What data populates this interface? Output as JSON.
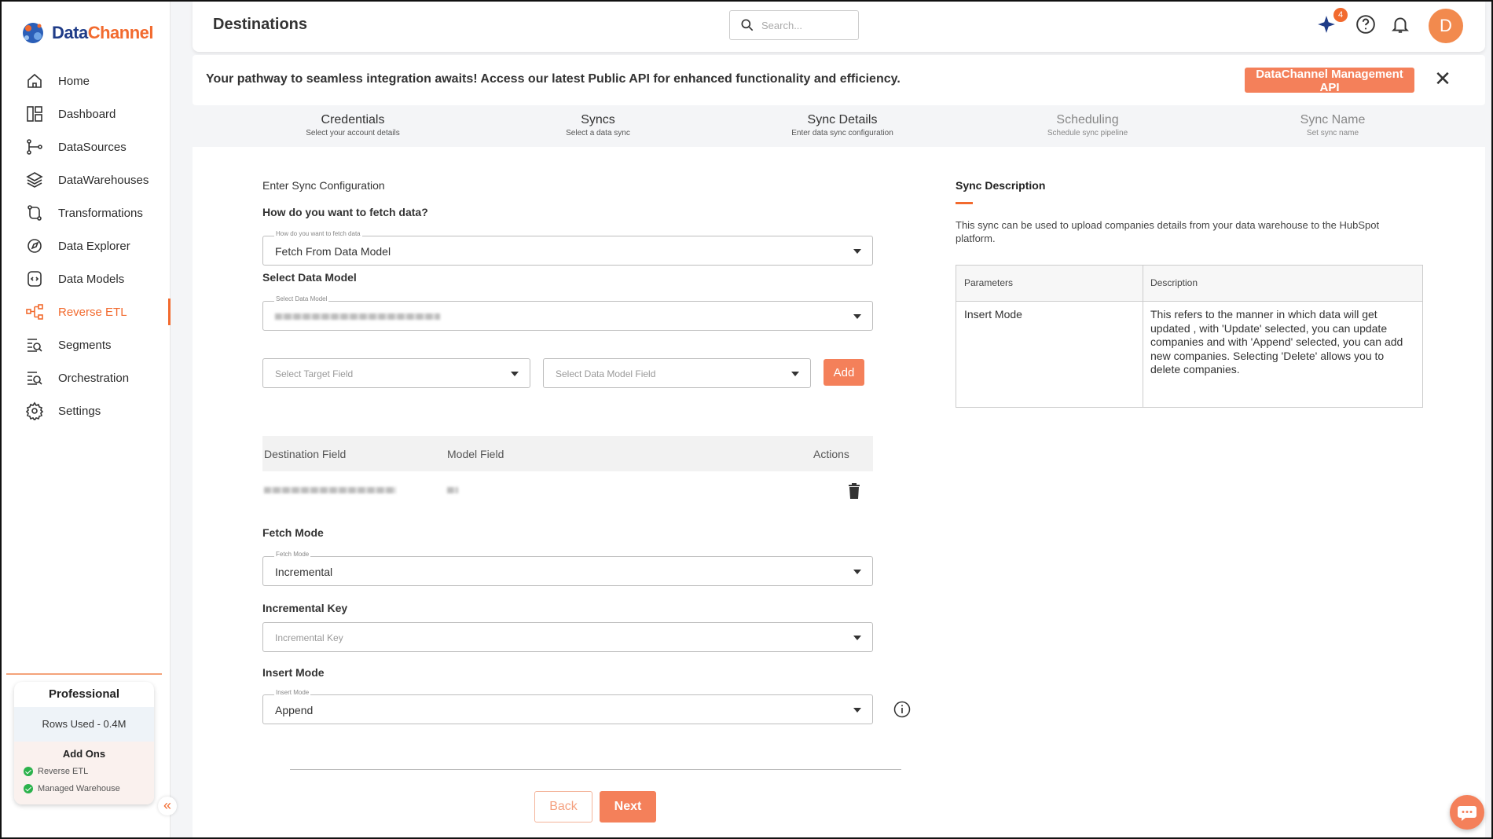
{
  "app": {
    "brand_part1": "Data",
    "brand_part2": "Channel",
    "accent_color": "#f26a2e"
  },
  "sidebar": {
    "items": [
      {
        "label": "Home",
        "icon": "home-icon"
      },
      {
        "label": "Dashboard",
        "icon": "dashboard-icon"
      },
      {
        "label": "DataSources",
        "icon": "datasources-icon"
      },
      {
        "label": "DataWarehouses",
        "icon": "layers-icon"
      },
      {
        "label": "Transformations",
        "icon": "transform-icon"
      },
      {
        "label": "Data Explorer",
        "icon": "explorer-icon"
      },
      {
        "label": "Data Models",
        "icon": "data-model-icon"
      },
      {
        "label": "Reverse ETL",
        "icon": "reverse-etl-icon",
        "active": true
      },
      {
        "label": "Segments",
        "icon": "segments-icon"
      },
      {
        "label": "Orchestration",
        "icon": "orchestration-icon"
      },
      {
        "label": "Settings",
        "icon": "gear-icon"
      }
    ],
    "plan": {
      "title": "Professional",
      "rows_used": "Rows Used - 0.4M",
      "addons_title": "Add Ons",
      "addons": [
        "Reverse ETL",
        "Managed Warehouse"
      ]
    }
  },
  "header": {
    "title": "Destinations",
    "search_placeholder": "Search...",
    "notifications_count": "4",
    "avatar_initial": "D"
  },
  "banner": {
    "text": "Your pathway to seamless integration awaits! Access our latest Public API for enhanced functionality and efficiency.",
    "button_label": "DataChannel Management API"
  },
  "stepper": [
    {
      "title": "Credentials",
      "sub": "Select your account details",
      "state": "done"
    },
    {
      "title": "Syncs",
      "sub": "Select a data sync",
      "state": "done"
    },
    {
      "title": "Sync Details",
      "sub": "Enter data sync configuration",
      "state": "current"
    },
    {
      "title": "Scheduling",
      "sub": "Schedule sync pipeline",
      "state": "pending"
    },
    {
      "title": "Sync Name",
      "sub": "Set sync name",
      "state": "pending"
    }
  ],
  "form": {
    "section_title": "Enter Sync Configuration",
    "fetch_question": "How do you want to fetch data?",
    "fetch_legend": "How do you want to fetch data",
    "fetch_value": "Fetch From Data Model",
    "select_model_label": "Select Data Model",
    "select_model_legend": "Select Data Model",
    "target_field_placeholder": "Select Target Field",
    "model_field_placeholder": "Select Data Model Field",
    "add_label": "Add",
    "mapping_headers": {
      "destination": "Destination Field",
      "model": "Model Field",
      "actions": "Actions"
    },
    "fetch_mode_label": "Fetch Mode",
    "fetch_mode_legend": "Fetch Mode",
    "fetch_mode_value": "Incremental",
    "incremental_key_label": "Incremental Key",
    "incremental_key_placeholder": "Incremental Key",
    "insert_mode_label": "Insert Mode",
    "insert_mode_legend": "Insert Mode",
    "insert_mode_value": "Append",
    "back_label": "Back",
    "next_label": "Next"
  },
  "description": {
    "title": "Sync Description",
    "text": "This sync can be used to upload companies details from your data warehouse to the HubSpot platform.",
    "table_headers": {
      "param": "Parameters",
      "desc": "Description"
    },
    "rows": [
      {
        "param": "Insert Mode",
        "desc": "This refers to the manner in which data will get updated , with 'Update' selected, you can update companies and with 'Append' selected, you can add new companies. Selecting 'Delete' allows you to delete companies."
      }
    ]
  }
}
